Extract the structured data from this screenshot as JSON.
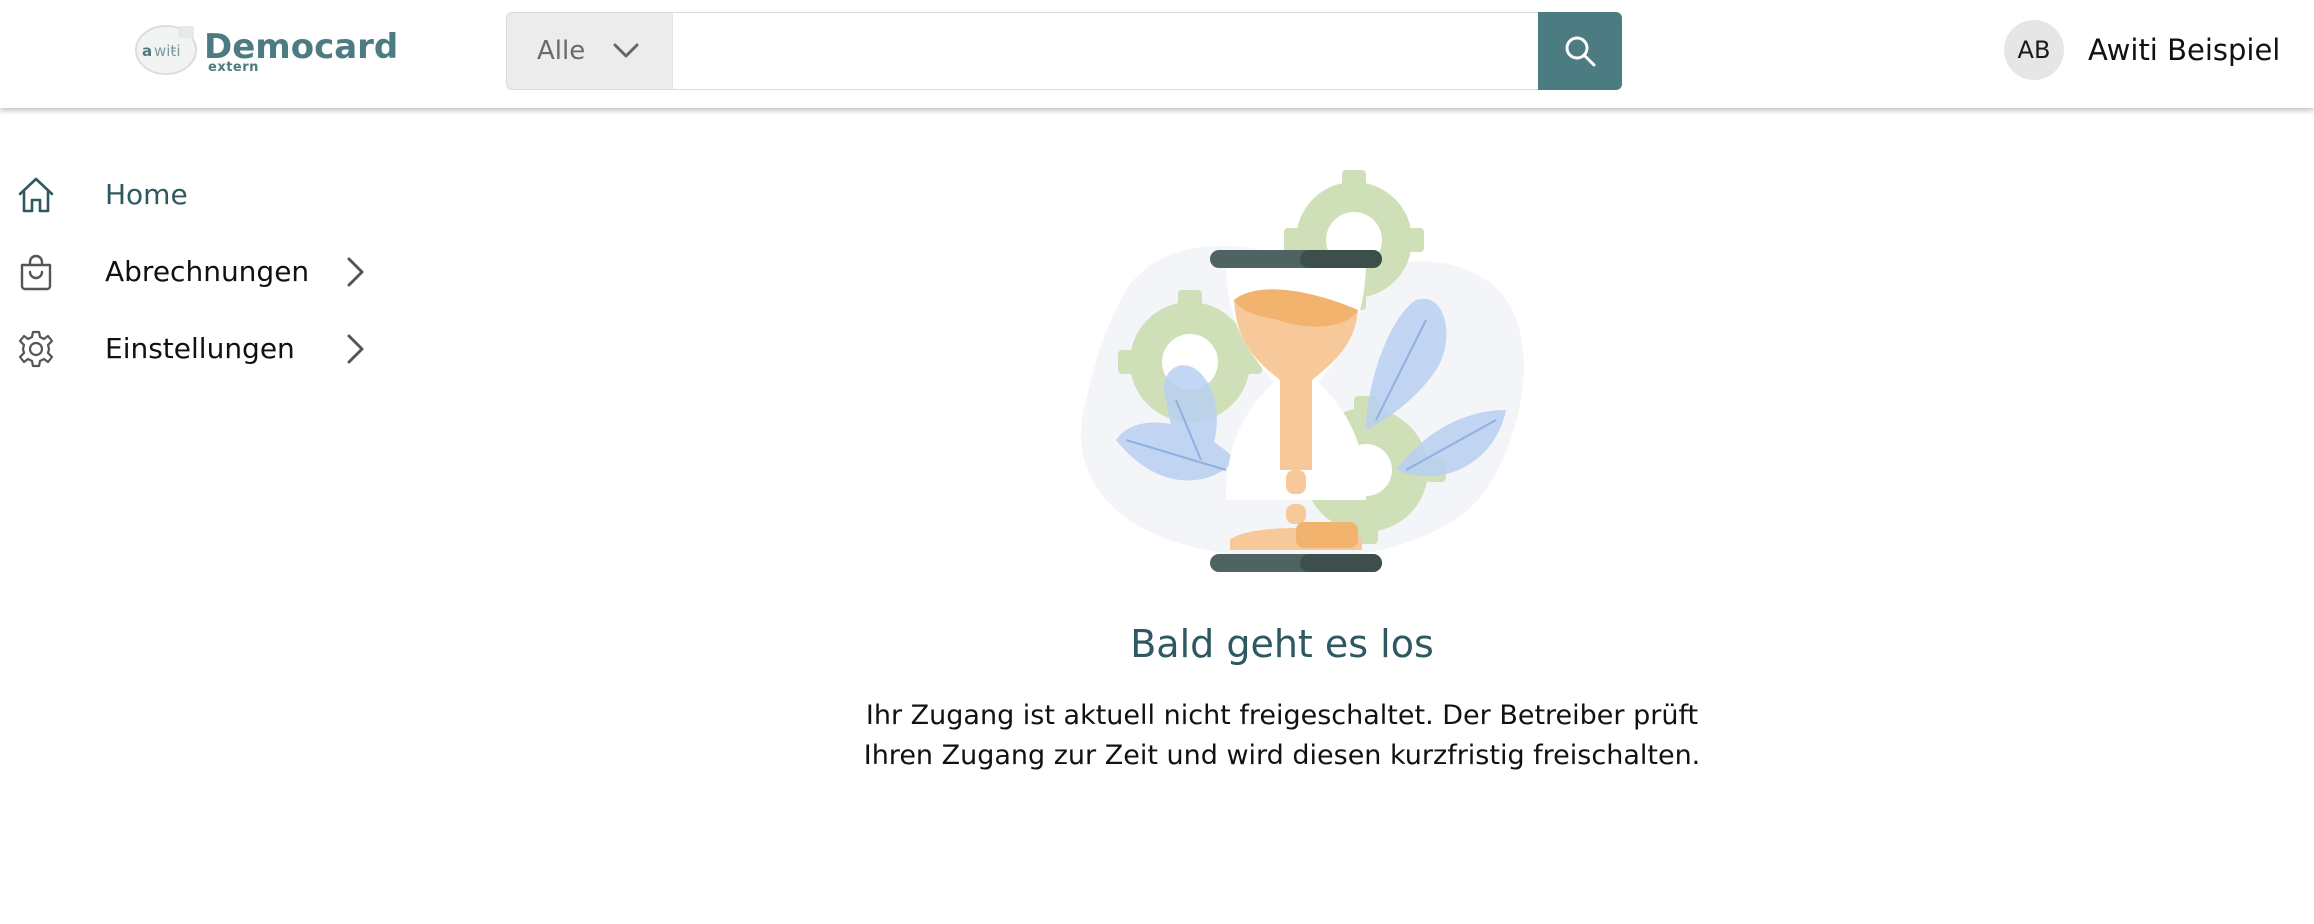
{
  "brand": {
    "name": "Democard",
    "sub": "extern",
    "mark_text": "awiti"
  },
  "search": {
    "filter_label": "Alle",
    "value": "",
    "placeholder": ""
  },
  "user": {
    "initials": "AB",
    "name": "Awiti Beispiel"
  },
  "sidebar": {
    "items": [
      {
        "label": "Home",
        "icon": "home-icon",
        "active": true,
        "expandable": false
      },
      {
        "label": "Abrechnungen",
        "icon": "shopping-bag-icon",
        "active": false,
        "expandable": true
      },
      {
        "label": "Einstellungen",
        "icon": "gear-icon",
        "active": false,
        "expandable": true
      }
    ]
  },
  "main": {
    "title": "Bald geht es los",
    "message_line1": "Ihr Zugang ist aktuell nicht freigeschaltet. Der Betreiber prüft",
    "message_line2": "Ihren Zugang zur Zeit und wird diesen kurzfristig freischalten."
  },
  "colors": {
    "accent": "#4d7b82",
    "heading": "#2f5960",
    "gear": "#cfe0b8",
    "leaf": "#b9d0f2",
    "sand": "#f7c99a"
  }
}
